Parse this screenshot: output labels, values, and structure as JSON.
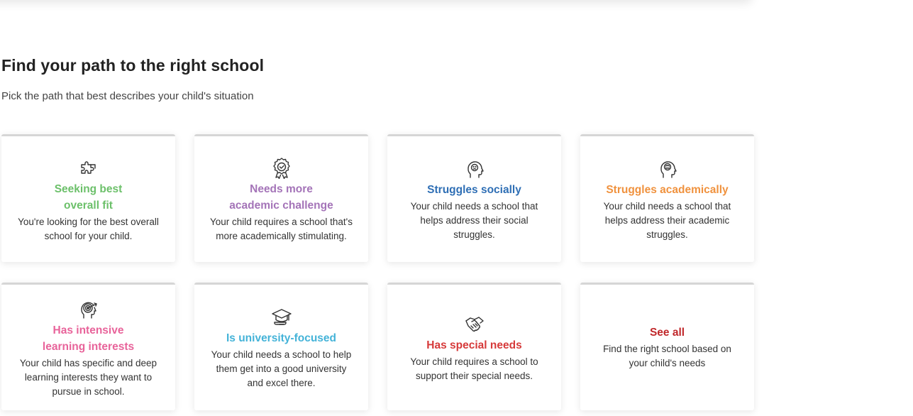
{
  "section": {
    "title": "Find your path to the right school",
    "subtitle": "Pick the path that best describes your child's situation"
  },
  "cards": [
    {
      "icon": "puzzle-icon",
      "title": "Seeking best\noverall fit",
      "color": "#6cc06a",
      "description": "You're looking for the best overall\nschool for your child."
    },
    {
      "icon": "award-ribbon-icon",
      "title": "Needs more\nacademic challenge",
      "color": "#a474b8",
      "description": "Your child requires a school that's\nmore academically stimulating."
    },
    {
      "icon": "head-social-icon",
      "title": "Struggles socially",
      "color": "#2f6fb5",
      "description": "Your child needs a school that\nhelps address their social\nstruggles."
    },
    {
      "icon": "head-brain-icon",
      "title": "Struggles academically",
      "color": "#f0923e",
      "description": "Your child needs a school that\nhelps address their academic\nstruggles."
    },
    {
      "icon": "head-target-icon",
      "title": "Has intensive\nlearning interests",
      "color": "#e8639a",
      "description": "Your child has specific and deep\nlearning interests they want to\npursue in school."
    },
    {
      "icon": "graduation-cap-icon",
      "title": "Is university-focused",
      "color": "#44b3d8",
      "description": "Your child needs a school to help\nthem get into a good university\nand excel there."
    },
    {
      "icon": "handshake-icon",
      "title": "Has special needs",
      "color": "#d63a3a",
      "description": "Your child requires a school to\nsupport their special needs."
    },
    {
      "icon": "",
      "title": "See all",
      "color": "#c0282b",
      "description": "Find the right school based on\nyour child's needs"
    }
  ]
}
